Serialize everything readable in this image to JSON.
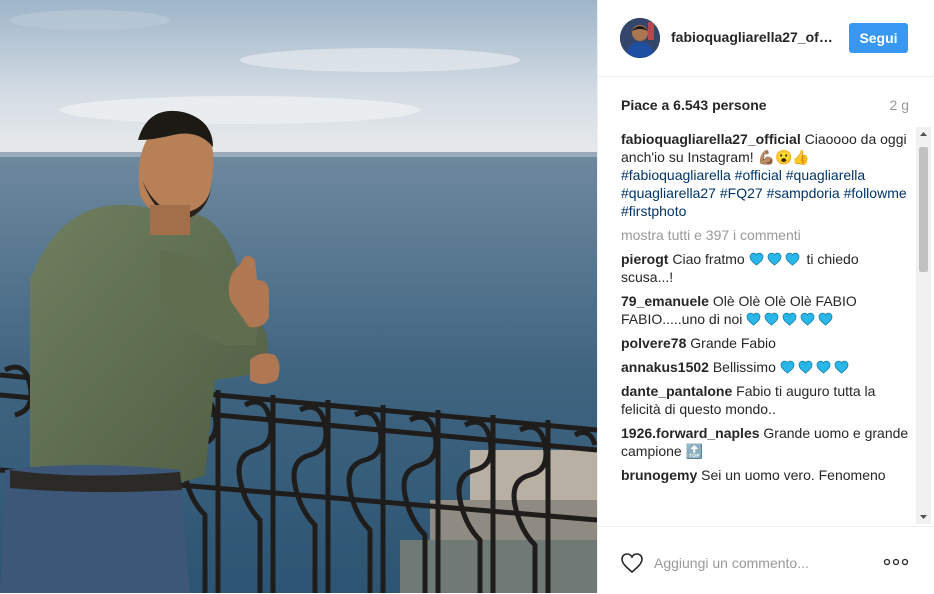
{
  "post": {
    "username": "fabioquagliarella27_official",
    "follow_label": "Segui",
    "likes_text": "Piace a 6.543 persone",
    "age": "2 g",
    "caption_user": "fabioquagliarella27_official",
    "caption_text": "Ciaoooo da oggi anch'io su Instagram! 💪🏽😮👍",
    "caption_hashtags": [
      "#fabioquagliarella",
      "#official",
      "#quagliarella",
      "#quagliarella27",
      "#FQ27",
      "#sampdoria",
      "#followme",
      "#firstphoto"
    ],
    "show_all_comments": "mostra tutti e 397 i commenti",
    "add_comment_placeholder": "Aggiungi un commento..."
  },
  "comments": [
    {
      "user": "pierogt",
      "before": "Ciao fratmo",
      "hearts": 3,
      "after": "ti chiedo scusa...!"
    },
    {
      "user": "79_emanuele",
      "before": "Olè Olè Olè Olè FABIO FABIO.....uno di noi",
      "hearts": 5,
      "after": ""
    },
    {
      "user": "polvere78",
      "before": "Grande Fabio",
      "hearts": 0,
      "after": ""
    },
    {
      "user": "annakus1502",
      "before": "Bellissimo",
      "hearts": 4,
      "after": ""
    },
    {
      "user": "dante_pantalone",
      "before": "Fabio ti auguro tutta la felicità di questo mondo..",
      "hearts": 0,
      "after": ""
    },
    {
      "user": "1926.forward_naples",
      "before": "Grande uomo e grande campione",
      "hearts": 0,
      "after": "🔝"
    },
    {
      "user": "brunogemy",
      "before": "Sei un uomo vero. Fenomeno",
      "hearts": 0,
      "after": ""
    }
  ],
  "icons": {
    "like": "heart-outline-icon",
    "more": "more-options-icon",
    "heart_emoji": "blue-heart-emoji"
  },
  "colors": {
    "accent": "#3897f0",
    "hashtag": "#003569",
    "muted": "#999999",
    "heart_emoji": "#29b6e8"
  }
}
